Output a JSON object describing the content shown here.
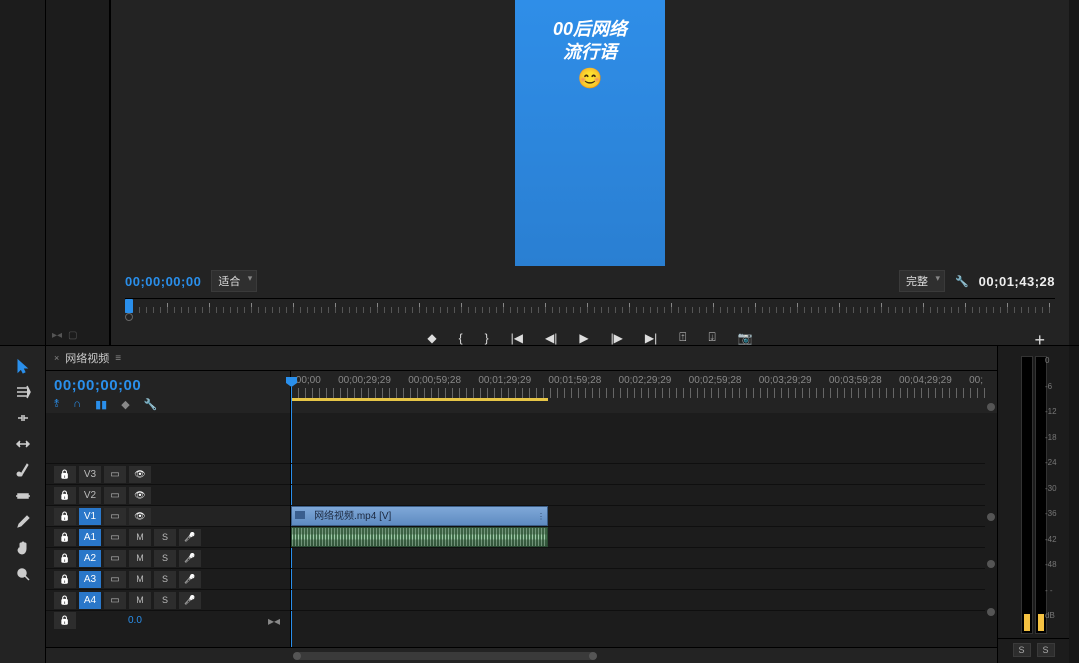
{
  "preview": {
    "line1": "00后网络",
    "line2": "流行语",
    "emoji": "😊"
  },
  "monitor": {
    "position_tc": "00;00;00;00",
    "fit_label": "适合",
    "quality_label": "完整",
    "duration_tc": "00;01;43;28"
  },
  "timeline": {
    "tab_name": "网络视频",
    "tab_menu": "≡",
    "position_tc": "00;00;00;00",
    "ruler": [
      ";00;00",
      "00;00;29;29",
      "00;00;59;28",
      "00;01;29;29",
      "00;01;59;28",
      "00;02;29;29",
      "00;02;59;28",
      "00;03;29;29",
      "00;03;59;28",
      "00;04;29;29",
      "00;"
    ],
    "tracks": {
      "v3": "V3",
      "v2": "V2",
      "v1": "V1",
      "a1": "A1",
      "a2": "A2",
      "a3": "A3",
      "a4": "A4",
      "m": "M",
      "s": "S"
    },
    "clip_name": "网络视频.mp4 [V]",
    "seq_value": "0.0"
  },
  "meters": {
    "scale": [
      "0",
      "-6",
      "-12",
      "-18",
      "-24",
      "-30",
      "-36",
      "-42",
      "-48",
      "- -",
      "dB"
    ],
    "solo": "S"
  }
}
